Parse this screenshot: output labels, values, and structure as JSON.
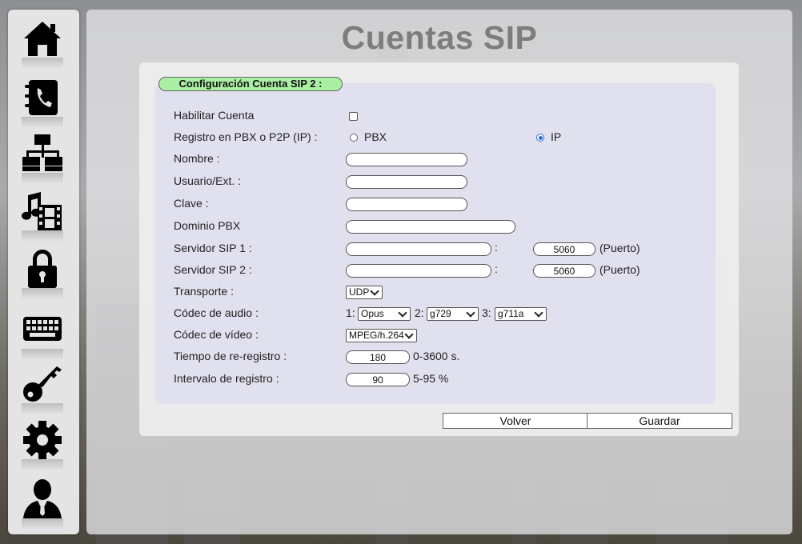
{
  "page": {
    "title": "Cuentas SIP"
  },
  "sidebar": {
    "items": [
      {
        "icon": "home-icon"
      },
      {
        "icon": "phonebook-icon"
      },
      {
        "icon": "network-icon"
      },
      {
        "icon": "media-icon"
      },
      {
        "icon": "lock-icon"
      },
      {
        "icon": "keyboard-icon"
      },
      {
        "icon": "key-icon"
      },
      {
        "icon": "gear-icon"
      },
      {
        "icon": "user-icon"
      }
    ]
  },
  "form": {
    "legend": "Configuración Cuenta SIP 2 :",
    "habilitar": {
      "label": "Habilitar Cuenta",
      "checked": false
    },
    "registro": {
      "label": "Registro en PBX o P2P (IP) :",
      "opt_pbx": "PBX",
      "opt_ip": "IP",
      "selected": "IP"
    },
    "nombre": {
      "label": "Nombre :",
      "value": ""
    },
    "usuario": {
      "label": "Usuario/Ext. :",
      "value": ""
    },
    "clave": {
      "label": "Clave :",
      "value": ""
    },
    "dominio": {
      "label": "Dominio PBX",
      "value": ""
    },
    "servidor1": {
      "label": "Servidor SIP 1 :",
      "value": "",
      "sep": ":",
      "port": "5060",
      "port_label": "(Puerto)"
    },
    "servidor2": {
      "label": "Servidor SIP 2 :",
      "value": "",
      "sep": ":",
      "port": "5060",
      "port_label": "(Puerto)"
    },
    "transporte": {
      "label": "Transporte :",
      "value": "UDP"
    },
    "codec_audio": {
      "label": "Códec de audio :",
      "n1": "1:",
      "v1": "Opus",
      "n2": "2:",
      "v2": "g729",
      "n3": "3:",
      "v3": "g711a"
    },
    "codec_video": {
      "label": "Códec de vídeo :",
      "value": "MPEG/h.264"
    },
    "tiempo": {
      "label": "Tiempo de re-registro :",
      "value": "180",
      "range": "0-3600 s."
    },
    "intervalo": {
      "label": "Intervalo de registro :",
      "value": "90",
      "range": "5-95 %"
    }
  },
  "buttons": {
    "volver": "Volver",
    "guardar": "Guardar"
  }
}
